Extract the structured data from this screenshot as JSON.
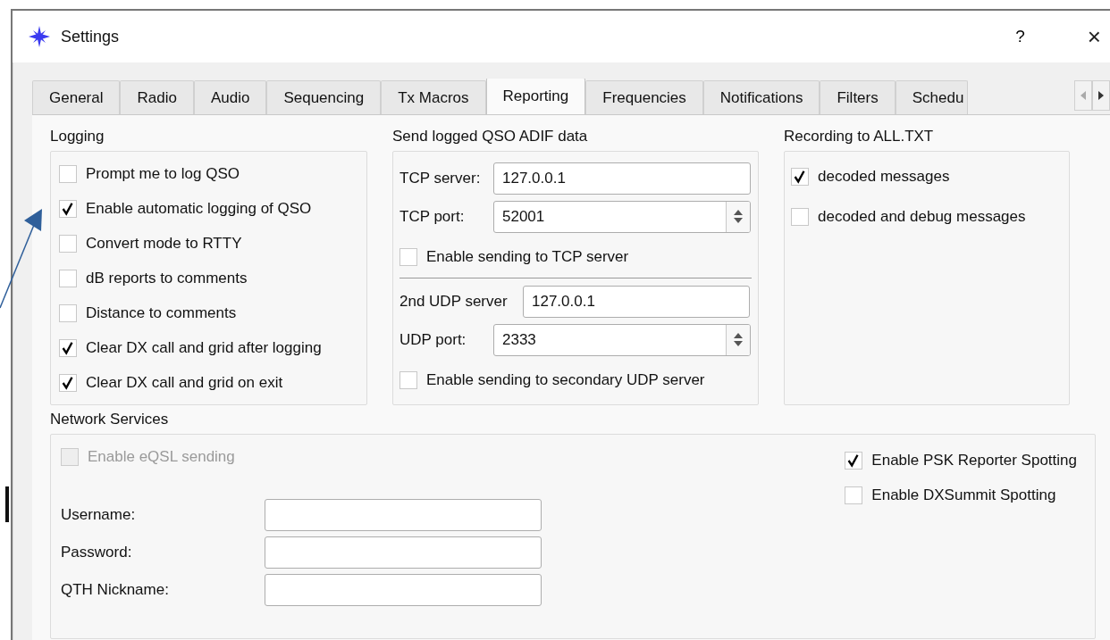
{
  "window": {
    "title": "Settings",
    "help": "?",
    "close": "×"
  },
  "tabs": [
    {
      "label": "General",
      "selected": false
    },
    {
      "label": "Radio",
      "selected": false
    },
    {
      "label": "Audio",
      "selected": false
    },
    {
      "label": "Sequencing",
      "selected": false
    },
    {
      "label": "Tx Macros",
      "selected": false
    },
    {
      "label": "Reporting",
      "selected": true
    },
    {
      "label": "Frequencies",
      "selected": false
    },
    {
      "label": "Notifications",
      "selected": false
    },
    {
      "label": "Filters",
      "selected": false
    },
    {
      "label": "Schedu",
      "selected": false
    }
  ],
  "logging": {
    "title": "Logging",
    "options": [
      {
        "label": "Prompt me to log QSO",
        "checked": false
      },
      {
        "label": "Enable automatic logging of QSO",
        "checked": true
      },
      {
        "label": "Convert mode to RTTY",
        "checked": false
      },
      {
        "label": "dB reports to comments",
        "checked": false
      },
      {
        "label": "Distance to comments",
        "checked": false
      },
      {
        "label": "Clear DX call and grid after logging",
        "checked": true
      },
      {
        "label": "Clear DX call and grid on exit",
        "checked": true
      }
    ]
  },
  "adif": {
    "title": "Send logged QSO ADIF data",
    "rows": [
      {
        "kind": "field",
        "label": "TCP server:",
        "value": "127.0.0.1"
      },
      {
        "kind": "spin",
        "label": "TCP port:",
        "value": "52001"
      },
      {
        "kind": "check",
        "label": "Enable sending to TCP server",
        "checked": false
      },
      {
        "kind": "divider"
      },
      {
        "kind": "field",
        "label": "2nd UDP server",
        "value": "127.0.0.1"
      },
      {
        "kind": "spin",
        "label": "UDP port:",
        "value": "2333"
      },
      {
        "kind": "check",
        "label": "Enable sending to secondary UDP server",
        "checked": false
      }
    ]
  },
  "recording": {
    "title": "Recording to ALL.TXT",
    "options": [
      {
        "label": "decoded messages",
        "checked": true
      },
      {
        "label": "decoded and debug messages",
        "checked": false
      }
    ]
  },
  "network": {
    "title": "Network Services",
    "eqsl": {
      "label": "Enable eQSL sending",
      "checked": false,
      "disabled": true
    },
    "spotting": [
      {
        "label": "Enable PSK Reporter Spotting",
        "checked": true
      },
      {
        "label": "Enable DXSummit Spotting",
        "checked": false
      }
    ],
    "fields": [
      {
        "label": "Username:"
      },
      {
        "label": "Password:"
      },
      {
        "label": "QTH Nickname:"
      }
    ]
  }
}
